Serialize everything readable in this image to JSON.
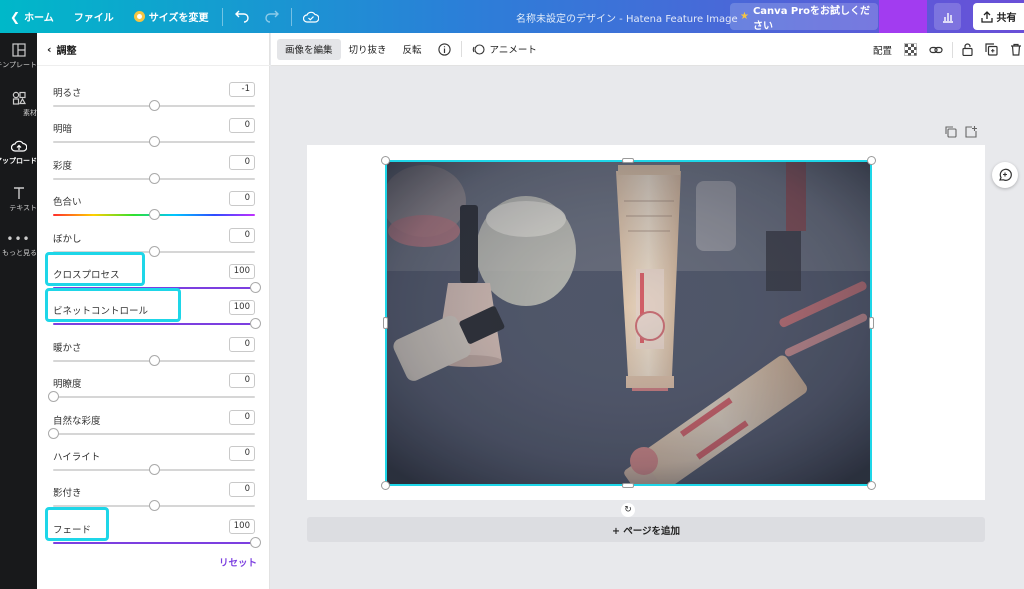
{
  "topbar": {
    "home": "ホーム",
    "file": "ファイル",
    "resize": "サイズを変更",
    "doc_title": "名称未設定のデザイン - Hatena Feature Image",
    "pro_trial": "Canva Proをお試しください",
    "share": "共有",
    "gradient_start": "#00b8c9",
    "gradient_end": "#6a4fd8",
    "pro_accent": "#f5c542",
    "purple_block": "#a23cf0"
  },
  "rail": {
    "items": [
      {
        "label": "テンプレート",
        "icon": "template-icon"
      },
      {
        "label": "素材",
        "icon": "elements-icon"
      },
      {
        "label": "アップロード",
        "icon": "upload-icon"
      },
      {
        "label": "テキスト",
        "icon": "text-icon"
      },
      {
        "label": "もっと見る",
        "icon": "more-icon"
      }
    ]
  },
  "panel": {
    "title": "調整",
    "reset": "リセット",
    "accent": "#7c3fe0",
    "highlight": "#1ed6e8",
    "adjustments": [
      {
        "label": "明るさ",
        "value": "-1",
        "level": 0.5,
        "track": "plain"
      },
      {
        "label": "明暗",
        "value": "0",
        "level": 0.5,
        "track": "plain"
      },
      {
        "label": "彩度",
        "value": "0",
        "level": 0.5,
        "track": "plain"
      },
      {
        "label": "色合い",
        "value": "0",
        "level": 0.5,
        "track": "rainbow"
      },
      {
        "label": "ぼかし",
        "value": "0",
        "level": 0.5,
        "track": "plain"
      },
      {
        "label": "クロスプロセス",
        "value": "100",
        "level": 1.0,
        "track": "fill",
        "highlighted": true
      },
      {
        "label": "ビネットコントロール",
        "value": "100",
        "level": 1.0,
        "track": "fill",
        "highlighted": true
      },
      {
        "label": "暖かさ",
        "value": "0",
        "level": 0.5,
        "track": "plain"
      },
      {
        "label": "明瞭度",
        "value": "0",
        "level": 0.0,
        "track": "plain"
      },
      {
        "label": "自然な彩度",
        "value": "0",
        "level": 0.0,
        "track": "plain"
      },
      {
        "label": "ハイライト",
        "value": "0",
        "level": 0.5,
        "track": "plain"
      },
      {
        "label": "影付き",
        "value": "0",
        "level": 0.5,
        "track": "plain"
      },
      {
        "label": "フェード",
        "value": "100",
        "level": 1.0,
        "track": "fill",
        "highlighted": true
      }
    ]
  },
  "context_toolbar": {
    "edit_image": "画像を編集",
    "crop": "切り抜き",
    "flip": "反転",
    "animate": "アニメート",
    "position": "配置"
  },
  "canvas": {
    "add_page": "+ ページを追加",
    "selection_color": "#1ed6e8"
  }
}
